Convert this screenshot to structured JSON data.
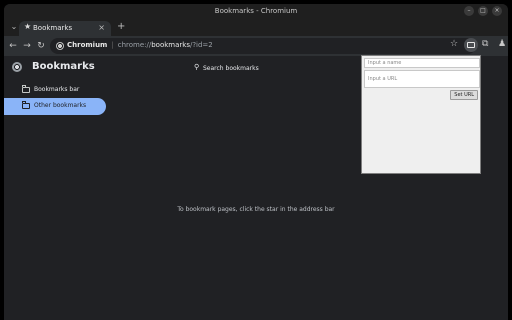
{
  "window": {
    "title": "Bookmarks - Chromium"
  },
  "tabs": [
    {
      "title": "Bookmarks",
      "icon": "star-icon"
    }
  ],
  "omnibox": {
    "site": "Chromium",
    "url_prefix": "chrome://",
    "url_host": "bookmarks",
    "url_suffix": "/?id=2"
  },
  "page": {
    "title": "Bookmarks",
    "search_placeholder": "Search bookmarks",
    "folders": [
      {
        "label": "Bookmarks bar",
        "selected": false
      },
      {
        "label": "Other bookmarks",
        "selected": true
      }
    ],
    "empty_message": "To bookmark pages, click the star in the address bar"
  },
  "popup": {
    "name_placeholder": "Input a name",
    "url_placeholder": "Input a URL",
    "button_label": "Set URL"
  },
  "colors": {
    "accent": "#8ab4f8",
    "background": "#202124"
  }
}
